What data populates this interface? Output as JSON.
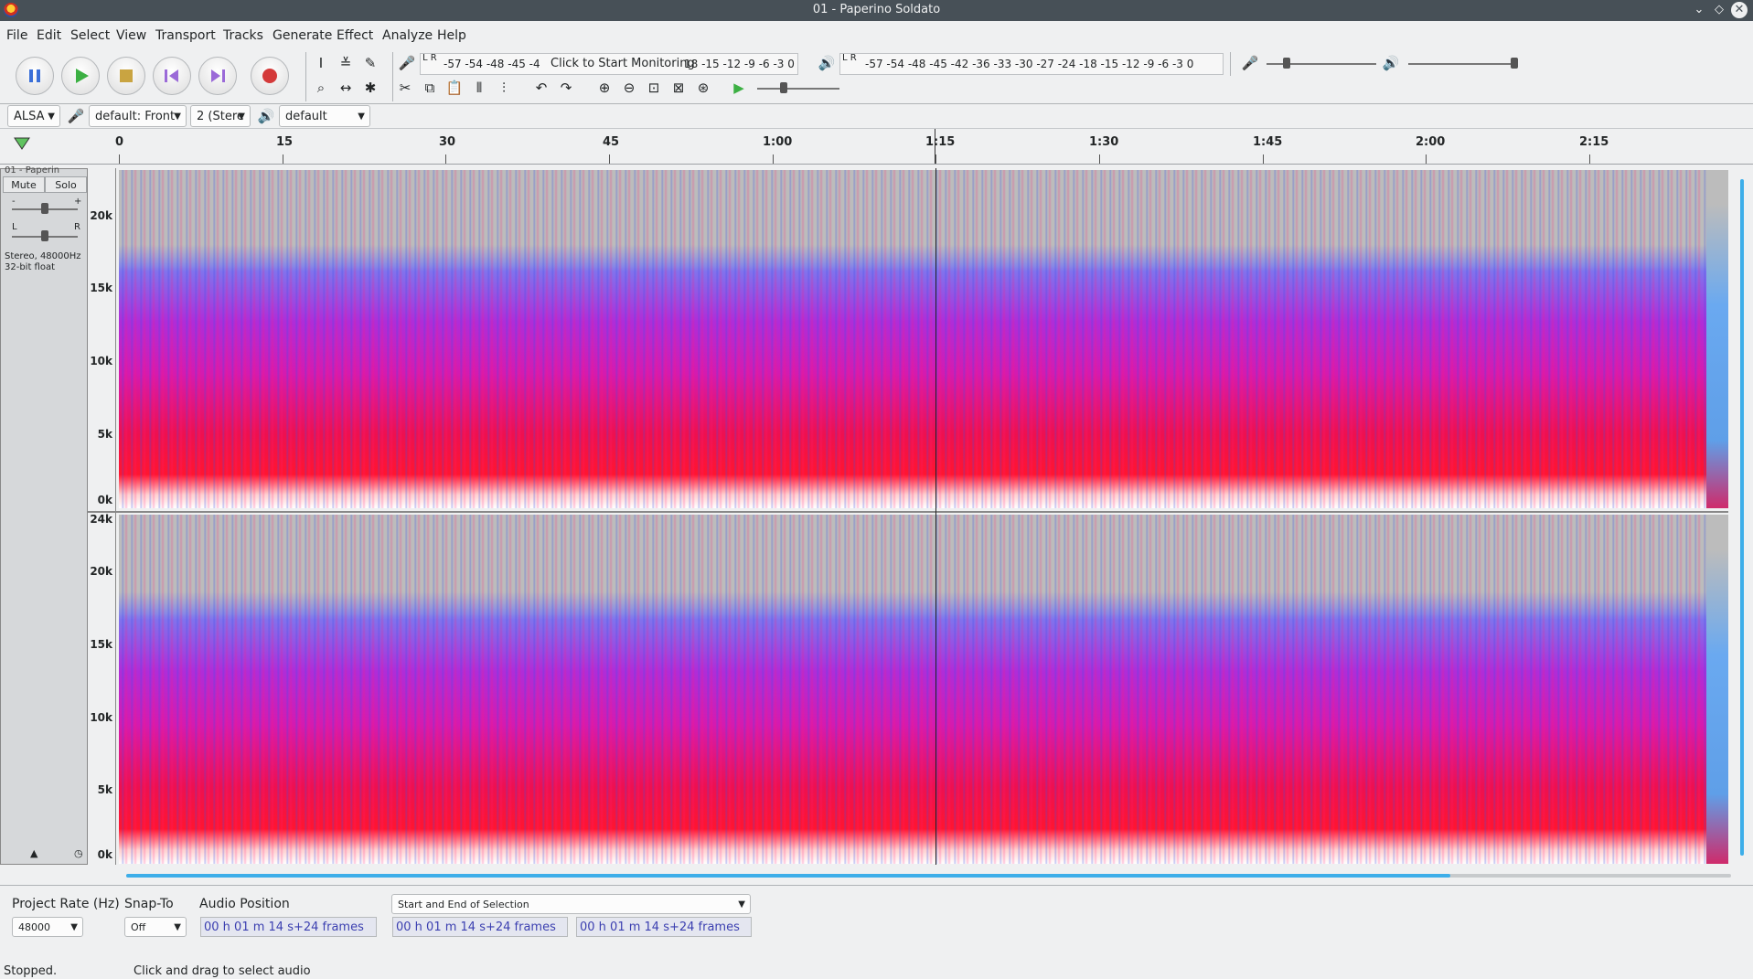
{
  "window": {
    "title": "01 - Paperino Soldato"
  },
  "menu": [
    "File",
    "Edit",
    "Select",
    "View",
    "Transport",
    "Tracks",
    "Generate",
    "Effect",
    "Analyze",
    "Help"
  ],
  "transport": {
    "buttons": [
      "pause",
      "play",
      "stop",
      "skip-to-start",
      "skip-to-end",
      "record"
    ]
  },
  "meters": {
    "record_channels": "L\nR",
    "record_scale": "-57 -54    -48 -45 -4",
    "record_prompt": "Click to Start Monitoring",
    "record_scale_right": "18 -15 -12  -9  -6  -3  0",
    "play_scale": "-57 -54    -48 -45 -42    -36 -33 -30 -27 -24    -18 -15 -12  -9  -6  -3  0"
  },
  "device": {
    "host": "ALSA",
    "recording_device": "default: Front",
    "channels": "2 (Stere",
    "playback_device": "default"
  },
  "ruler": {
    "ticks": [
      "0",
      "15",
      "30",
      "45",
      "1:00",
      "1:15",
      "1:30",
      "1:45",
      "2:00",
      "2:15"
    ]
  },
  "track": {
    "name": "01 - Paperin",
    "mute": "Mute",
    "solo": "Solo",
    "info_line1": "Stereo, 48000Hz",
    "info_line2": "32-bit float",
    "scale_top": [
      "20k",
      "15k",
      "10k",
      "5k",
      "0k"
    ],
    "scale_bottom": [
      "24k",
      "20k",
      "15k",
      "10k",
      "5k",
      "0k"
    ]
  },
  "selection_toolbar": {
    "project_rate_label": "Project Rate (Hz)",
    "project_rate": "48000",
    "snap_to_label": "Snap-To",
    "snap_to": "Off",
    "audio_position_label": "Audio Position",
    "selection_mode": "Start and End of Selection",
    "audio_position": "00 h 01 m 14 s+24 frames",
    "selection_start": "00 h 01 m 14 s+24 frames",
    "selection_end": "00 h 01 m 14 s+24 frames"
  },
  "status": {
    "state": "Stopped.",
    "hint": "Click and drag to select audio"
  },
  "colors": {
    "accent": "#3daee9",
    "titlebar": "#475057",
    "spectrogram_high": "#ff1530",
    "spectrogram_mid": "#b02cd8",
    "spectrogram_low": "#7a7cf0"
  }
}
